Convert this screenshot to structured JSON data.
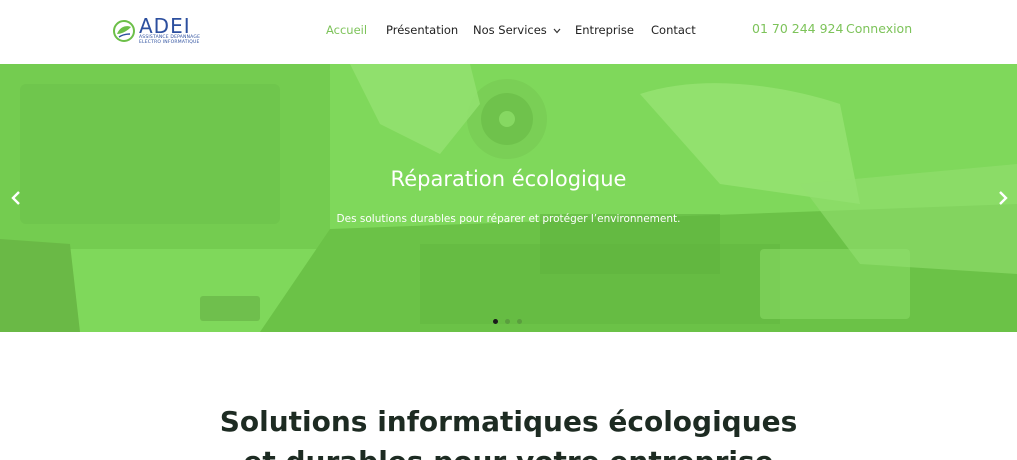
{
  "logo": {
    "name": "ADEI",
    "tagline_line1": "ASSISTANCE DEPANNAGE",
    "tagline_line2": "ELECTRO INFORMATIQUE"
  },
  "nav": {
    "items": [
      {
        "label": "Accueil",
        "active": true
      },
      {
        "label": "Présentation"
      },
      {
        "label": "Nos Services",
        "has_dropdown": true
      },
      {
        "label": "Entreprise"
      },
      {
        "label": "Contact"
      }
    ]
  },
  "header": {
    "phone": "01 70 244 924",
    "login_label": "Connexion"
  },
  "hero": {
    "title": "Réparation écologique",
    "subtitle": "Des solutions durables pour réparer et protéger l’environnement.",
    "slide_count": 3,
    "active_slide": 1,
    "overlay_color": "#7fd85b"
  },
  "section": {
    "title_line1": "Solutions informatiques écologiques",
    "title_line2": "et durables pour votre entreprise"
  },
  "colors": {
    "accent": "#7dc35a",
    "logo_blue": "#2c4f9e",
    "heading": "#1d2b22"
  }
}
